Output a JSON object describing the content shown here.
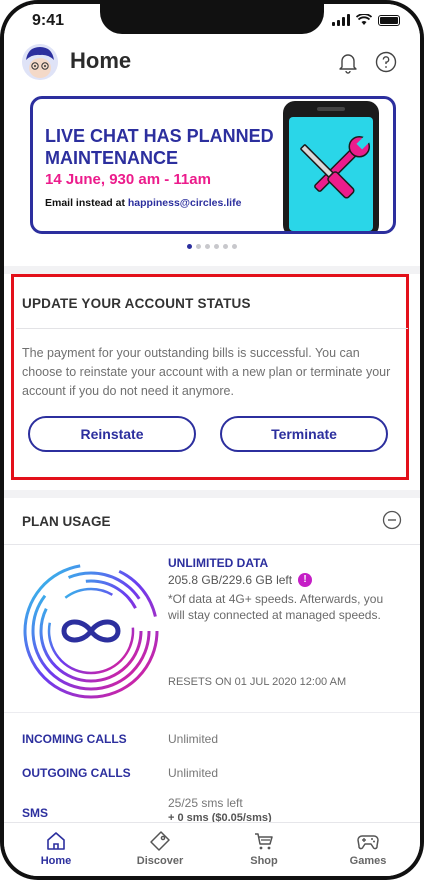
{
  "status_bar": {
    "time": "9:41"
  },
  "header": {
    "title": "Home"
  },
  "banner": {
    "title": "LIVE CHAT HAS PLANNED MAINTENANCE",
    "date": "14 June, 930 am - 11am",
    "email_prefix": "Email instead at ",
    "email": "happiness@circles.life",
    "slide_count": 6,
    "active_slide": 1
  },
  "account_status": {
    "title": "UPDATE YOUR ACCOUNT STATUS",
    "description": "The payment for your outstanding bills is successful. You can choose to reinstate your account with a new plan or terminate your account if you do not need it anymore.",
    "reinstate_label": "Reinstate",
    "terminate_label": "Terminate"
  },
  "plan_usage": {
    "title": "PLAN USAGE",
    "data_label": "UNLIMITED DATA",
    "data_left": "205.8 GB/229.6 GB left",
    "info_glyph": "!",
    "data_note": "*Of data at 4G+ speeds. Afterwards, you will stay connected at managed speeds.",
    "resets": "RESETS ON 01 JUL 2020 12:00 AM",
    "rows": [
      {
        "label": "INCOMING CALLS",
        "value": "Unlimited",
        "sub": ""
      },
      {
        "label": "OUTGOING CALLS",
        "value": "Unlimited",
        "sub": ""
      },
      {
        "label": "SMS",
        "value": "25/25 sms left",
        "sub": "+ 0 sms ($0.05/sms)"
      }
    ]
  },
  "bottom_nav": [
    {
      "label": "Home",
      "icon": "home-icon",
      "active": true
    },
    {
      "label": "Discover",
      "icon": "discover-icon",
      "active": false
    },
    {
      "label": "Shop",
      "icon": "shop-cart-icon",
      "active": false
    },
    {
      "label": "Games",
      "icon": "gamepad-icon",
      "active": false
    }
  ],
  "colors": {
    "brand": "#2c2f9e",
    "accent_pink": "#ec1c8c",
    "highlight_red": "#e3101a",
    "info_purple": "#c51ec6"
  }
}
